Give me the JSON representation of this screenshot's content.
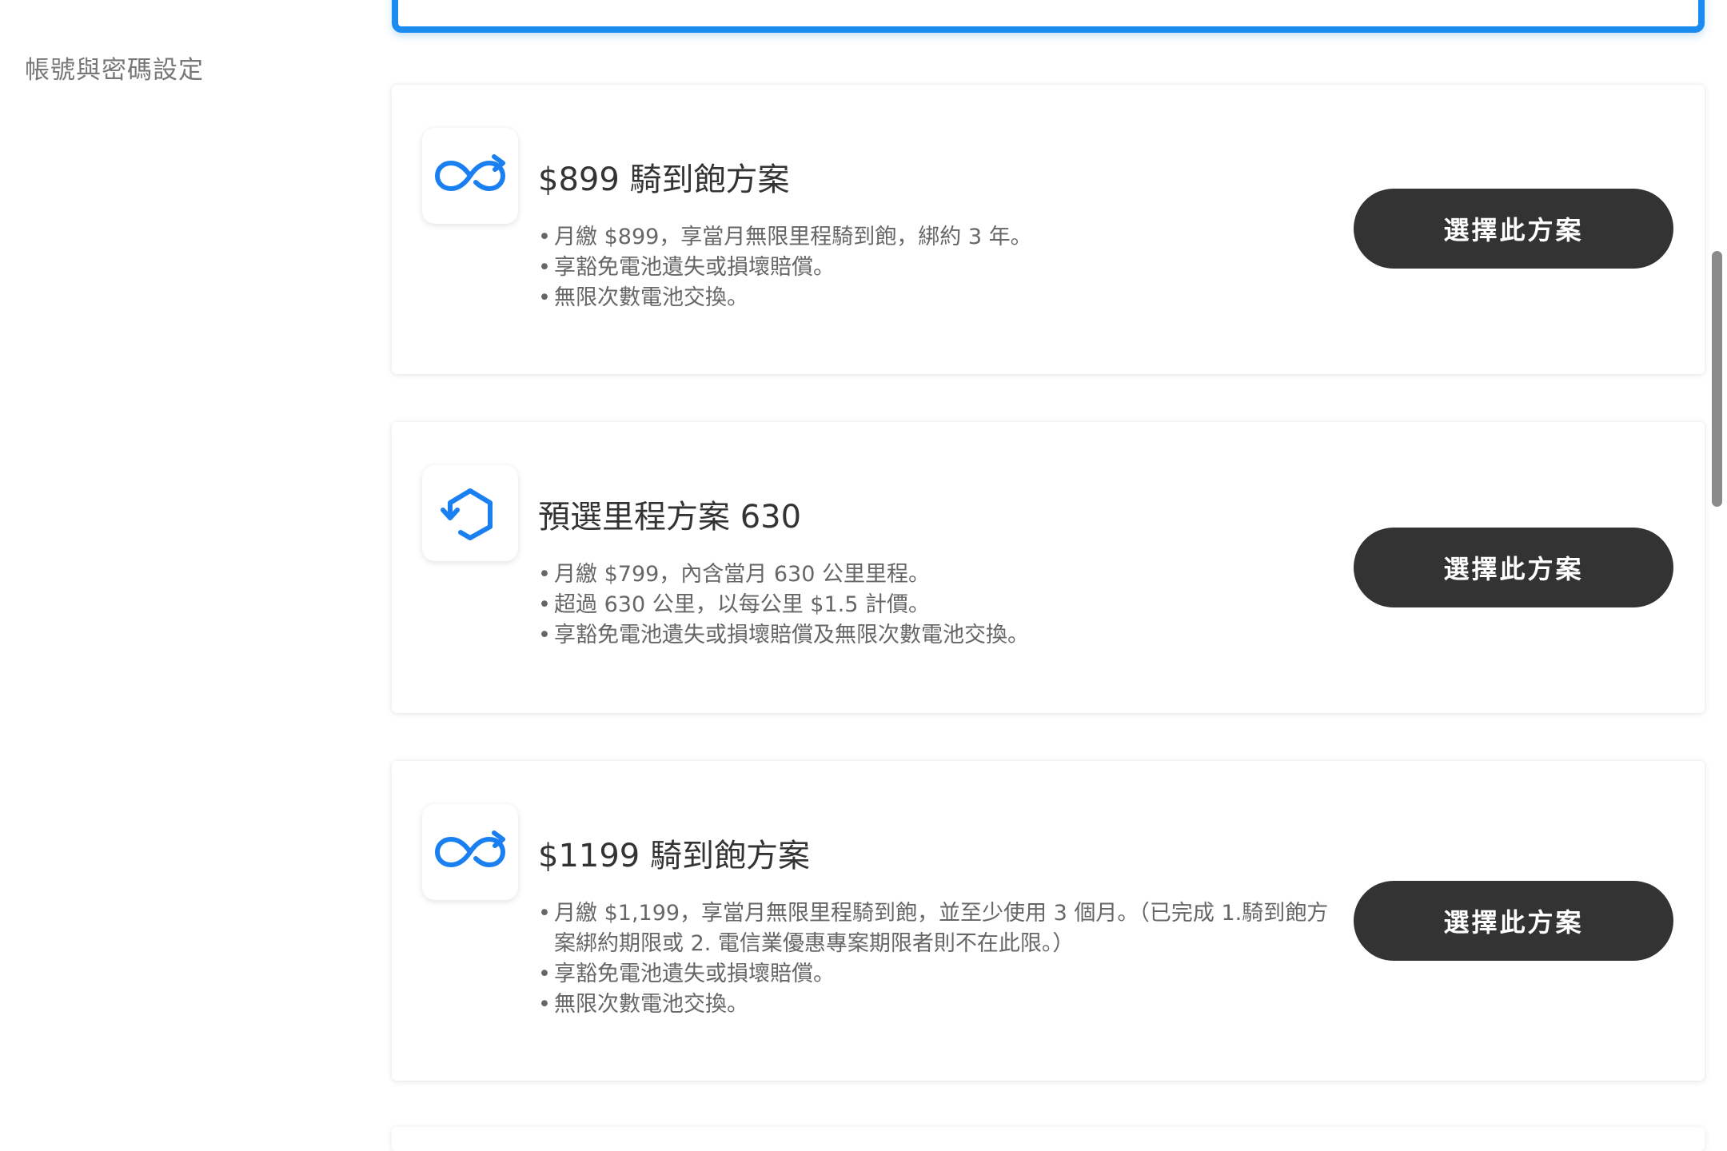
{
  "sidebar": {
    "account_settings_label": "帳號與密碼設定"
  },
  "plans": [
    {
      "icon": "infinity-refresh-icon",
      "title": "$899 騎到飽方案",
      "bullets": [
        "月繳 $899，享當月無限里程騎到飽，綁約 3 年。",
        "享豁免電池遺失或損壞賠償。",
        "無限次數電池交換。"
      ],
      "button_label": "選擇此方案"
    },
    {
      "icon": "hexagon-refresh-icon",
      "title": "預選里程方案 630",
      "bullets": [
        "月繳 $799，內含當月 630 公里里程。",
        "超過 630 公里，以每公里 $1.5 計價。",
        "享豁免電池遺失或損壞賠償及無限次數電池交換。"
      ],
      "button_label": "選擇此方案"
    },
    {
      "icon": "infinity-refresh-icon",
      "title": "$1199 騎到飽方案",
      "bullets": [
        "月繳 $1,199，享當月無限里程騎到飽，並至少使用 3 個月。（已完成 1.騎到飽方案綁約期限或 2. 電信業優惠專案期限者則不在此限。）",
        "享豁免電池遺失或損壞賠償。",
        "無限次數電池交換。"
      ],
      "button_label": "選擇此方案"
    }
  ],
  "colors": {
    "accent": "#1a8cf0",
    "button_bg": "#333333",
    "icon_blue": "#1a7ff0"
  }
}
